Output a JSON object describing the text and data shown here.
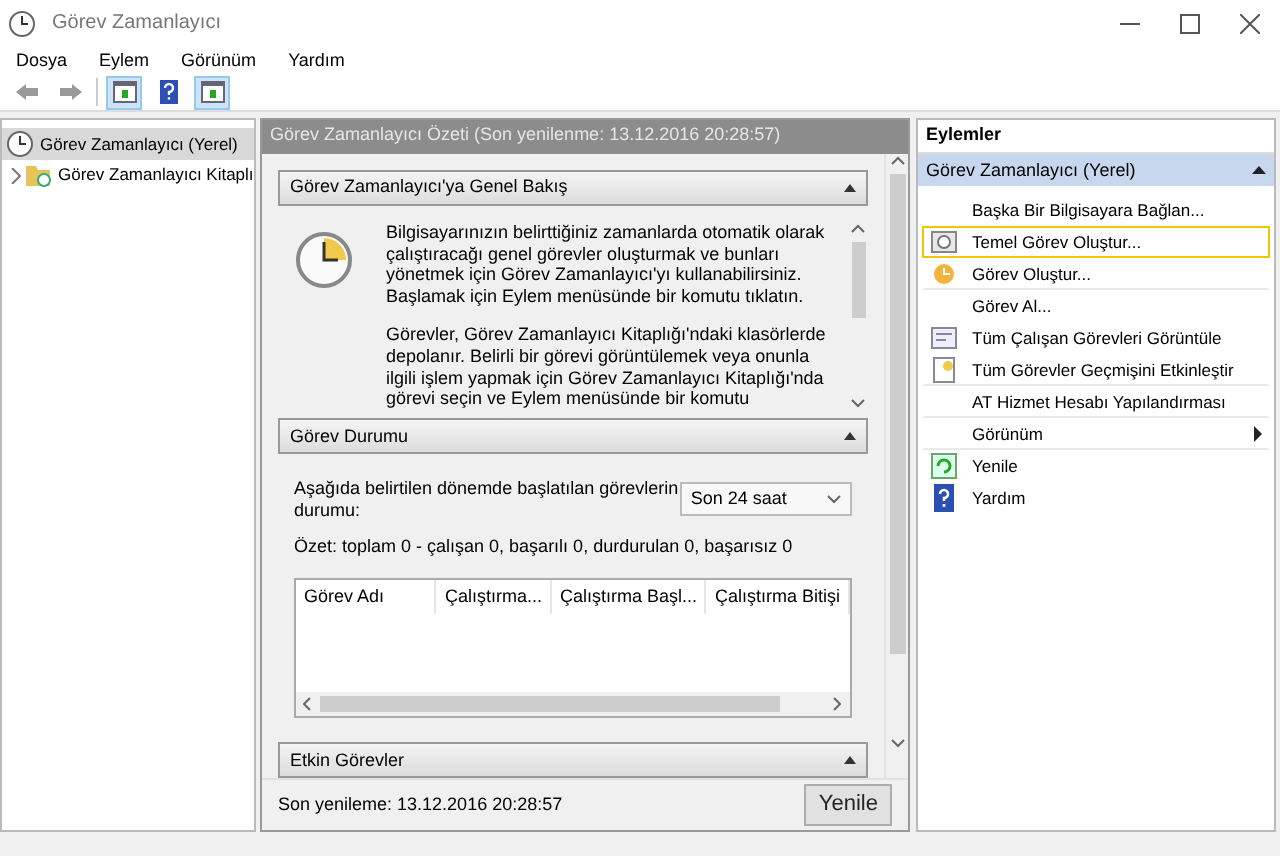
{
  "window": {
    "title": "Görev Zamanlayıcı"
  },
  "menu": [
    "Dosya",
    "Eylem",
    "Görünüm",
    "Yardım"
  ],
  "toolbar": [
    {
      "kind": "back",
      "disabled": true
    },
    {
      "kind": "forward",
      "disabled": true
    },
    {
      "kind": "tree",
      "selected": true
    },
    {
      "kind": "help",
      "selected": false
    },
    {
      "kind": "pane",
      "selected": true
    }
  ],
  "tree": [
    {
      "label": "Görev Zamanlayıcı (Yerel)",
      "selected": true,
      "children": [
        {
          "label": "Görev Zamanlayıcı Kitaplı",
          "selected": false,
          "expanded": false
        }
      ]
    }
  ],
  "summary": {
    "title": "Görev Zamanlayıcı Özeti (Son yenilenme: 13.12.2016 20:28:57)",
    "sections": [
      {
        "kind": "overview",
        "title": "Görev Zamanlayıcı'ya Genel Bakış",
        "expanded": true,
        "paragraphs": [
          "Bilgisayarınızın belirttiğiniz zamanlarda otomatik olarak çalıştıracağı genel görevler oluşturmak ve bunları yönetmek için Görev Zamanlayıcı'yı kullanabilirsiniz. Başlamak için Eylem menüsünde bir komutu tıklatın.",
          "Görevler, Görev Zamanlayıcı Kitaplığı'ndaki klasörlerde depolanır. Belirli bir görevi görüntülemek veya onunla ilgili işlem yapmak için Görev Zamanlayıcı Kitaplığı'nda görevi seçin ve Eylem menüsünde bir komutu"
        ]
      },
      {
        "kind": "status",
        "title": "Görev Durumu",
        "expanded": true,
        "period_label": "Aşağıda belirtilen dönemde başlatılan görevlerin durumu:",
        "period_value": "Son 24 saat",
        "summary": "Özet: toplam 0 - çalışan 0, başarılı 0, durdurulan 0, başarısız 0",
        "columns": [
          "Görev Adı",
          "Çalıştırma...",
          "Çalıştırma Başl...",
          "Çalıştırma Bitişi"
        ]
      },
      {
        "kind": "header",
        "title": "Etkin Görevler",
        "expanded": true
      }
    ],
    "last_refresh": "Son yenileme: 13.12.2016 20:28:57",
    "refresh_button": "Yenile"
  },
  "actions": {
    "title": "Eylemler",
    "group": {
      "label": "Görev Zamanlayıcı (Yerel)",
      "expanded": true
    },
    "items": [
      {
        "label": "Başka Bir Bilgisayara Bağlan...",
        "kind": "none",
        "highlighted": false,
        "submenu": false
      },
      {
        "label": "Temel Görev Oluştur...",
        "kind": "wizard",
        "highlighted": true,
        "submenu": false
      },
      {
        "label": "Görev Oluştur...",
        "kind": "task",
        "highlighted": false,
        "submenu": false
      },
      {
        "label": "Görev Al...",
        "kind": "none",
        "highlighted": false,
        "submenu": false
      },
      {
        "label": "Tüm Çalışan Görevleri Görüntüle",
        "kind": "running",
        "highlighted": false,
        "submenu": false
      },
      {
        "label": "Tüm Görevler Geçmişini Etkinleştir",
        "kind": "history",
        "highlighted": false,
        "submenu": false
      },
      {
        "label": "AT Hizmet Hesabı Yapılandırması",
        "kind": "none",
        "highlighted": false,
        "submenu": false
      },
      {
        "label": "Görünüm",
        "kind": "none",
        "highlighted": false,
        "submenu": true
      },
      {
        "label": "Yenile",
        "kind": "refresh",
        "highlighted": false,
        "submenu": false
      },
      {
        "label": "Yardım",
        "kind": "help",
        "highlighted": false,
        "submenu": false
      }
    ]
  }
}
